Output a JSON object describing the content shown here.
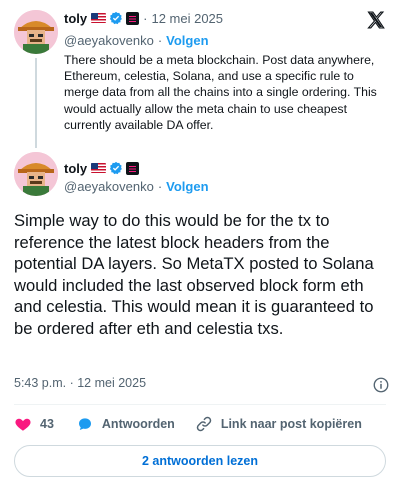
{
  "colors": {
    "accent": "#1d9bf0",
    "like": "#f91880",
    "muted": "#536471",
    "text": "#0f1419"
  },
  "parent_tweet": {
    "author_name": "toly",
    "handle": "@aeyakovenko",
    "follow_label": "Volgen",
    "separator": "·",
    "date": "12 mei 2025",
    "text": "There should be a meta blockchain. Post data anywhere, Ethereum, celestia, Solana, and use a specific rule to merge data from all the chains into a single ordering.  This would actually allow the meta chain to use cheapest currently available DA offer."
  },
  "main_tweet": {
    "author_name": "toly",
    "handle": "@aeyakovenko",
    "separator": "·",
    "follow_label": "Volgen",
    "text": "Simple way to do this would be for the tx to reference the latest block headers from the potential DA layers.  So MetaTX posted to Solana would included the last observed block form eth and celestia.  This would mean it is guaranteed to be ordered after eth and celestia txs.",
    "timestamp": "5:43 p.m. · 12 mei 2025"
  },
  "actions": {
    "like_count": "43",
    "reply_label": "Antwoorden",
    "copy_link_label": "Link naar post kopiëren"
  },
  "read_replies_label": "2 antwoorden lezen",
  "icons": {
    "logo": "x-logo-icon",
    "verified": "verified-badge-icon",
    "flag": "us-flag-icon",
    "affiliate": "affiliate-badge-icon",
    "info": "info-icon",
    "like": "heart-icon",
    "reply": "speech-bubble-icon",
    "copy": "link-icon"
  }
}
